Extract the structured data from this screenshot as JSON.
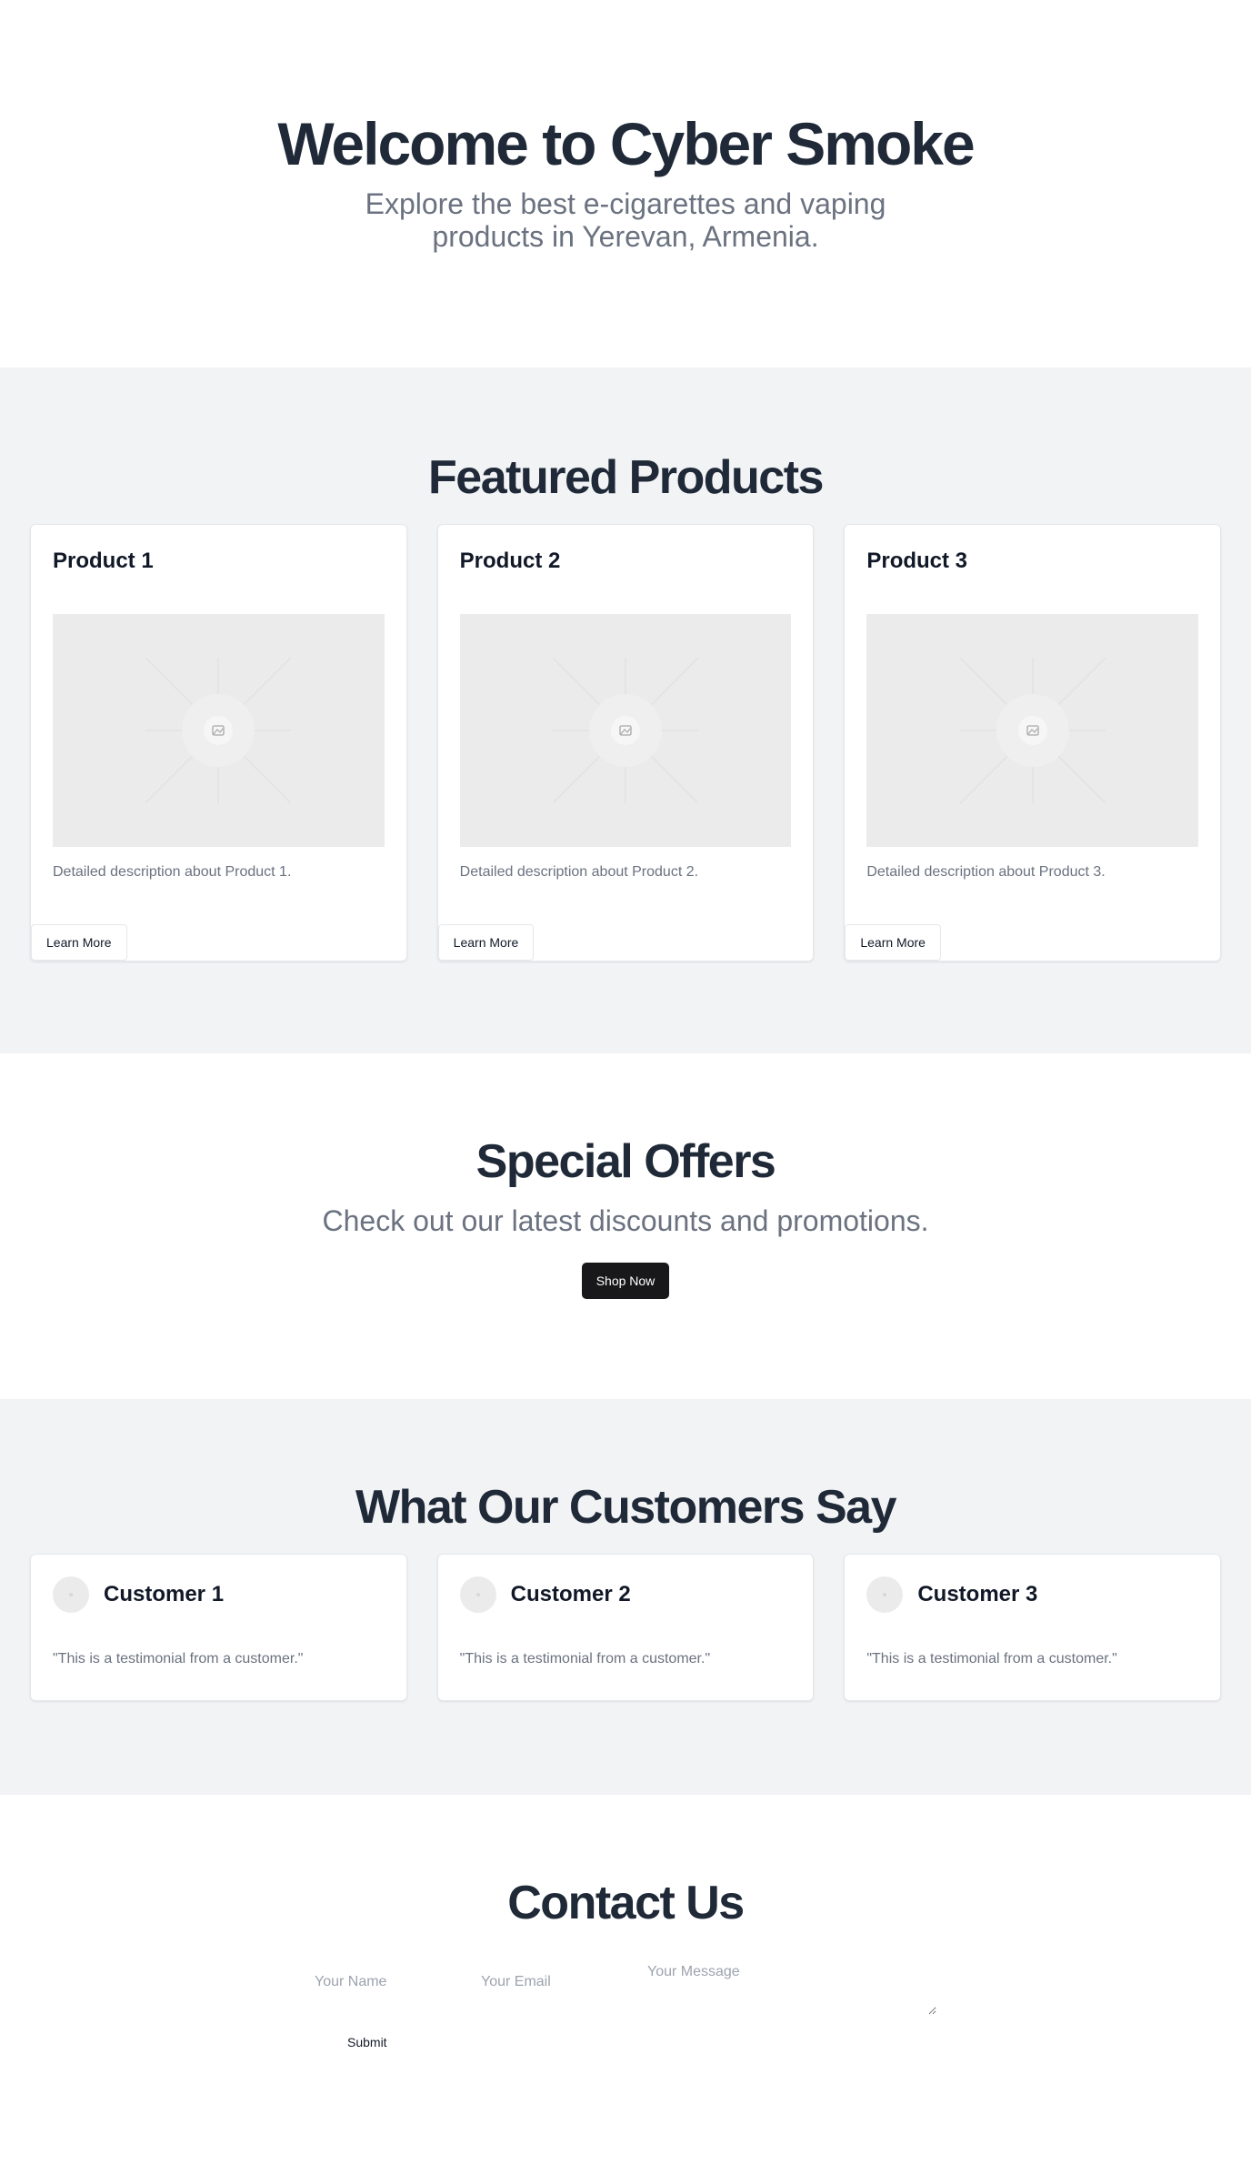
{
  "hero": {
    "title": "Welcome to Cyber Smoke",
    "subtitle": "Explore the best e-cigarettes and vaping products in Yerevan, Armenia."
  },
  "featured": {
    "title": "Featured Products",
    "products": [
      {
        "name": "Product 1",
        "description": "Detailed description about Product 1.",
        "button": "Learn More"
      },
      {
        "name": "Product 2",
        "description": "Detailed description about Product 2.",
        "button": "Learn More"
      },
      {
        "name": "Product 3",
        "description": "Detailed description about Product 3.",
        "button": "Learn More"
      }
    ]
  },
  "offers": {
    "title": "Special Offers",
    "text": "Check out our latest discounts and promotions.",
    "button": "Shop Now"
  },
  "testimonials": {
    "title": "What Our Customers Say",
    "items": [
      {
        "name": "Customer 1",
        "quote": "\"This is a testimonial from a customer.\""
      },
      {
        "name": "Customer 2",
        "quote": "\"This is a testimonial from a customer.\""
      },
      {
        "name": "Customer 3",
        "quote": "\"This is a testimonial from a customer.\""
      }
    ]
  },
  "contact": {
    "title": "Contact Us",
    "name_placeholder": "Your Name",
    "email_placeholder": "Your Email",
    "message_placeholder": "Your Message",
    "submit": "Submit"
  },
  "icons": {
    "product_image": "image-placeholder-icon",
    "avatar": "avatar-placeholder"
  },
  "colors": {
    "heading": "#1f2937",
    "muted_text": "#6b7280",
    "section_alt_bg": "#f2f3f5",
    "dark_button": "#18181b"
  }
}
